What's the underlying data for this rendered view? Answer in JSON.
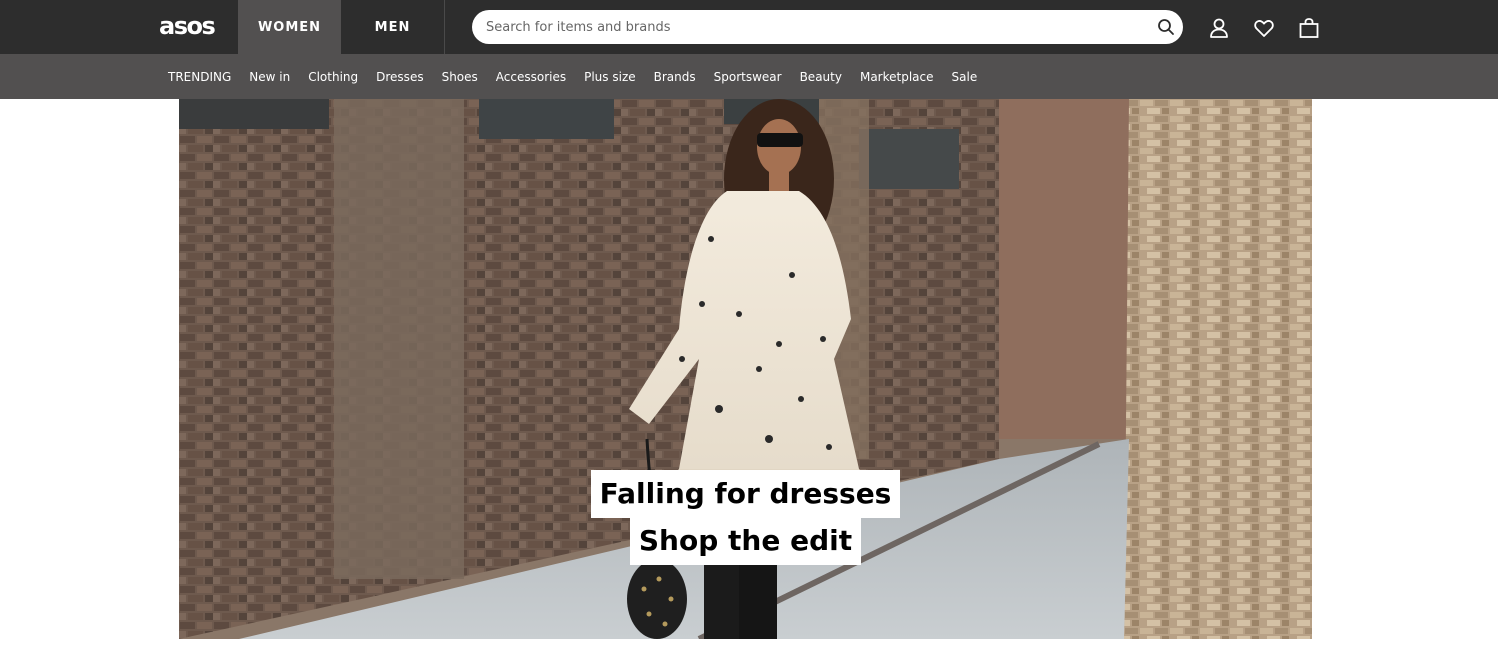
{
  "brand": {
    "logo_text": "asos"
  },
  "header": {
    "tabs": [
      {
        "label": "WOMEN",
        "active": true
      },
      {
        "label": "MEN",
        "active": false
      }
    ],
    "search": {
      "placeholder": "Search for items and brands",
      "value": ""
    },
    "icons": [
      "search-icon",
      "account-icon",
      "heart-icon",
      "bag-icon"
    ]
  },
  "nav": {
    "items": [
      {
        "label": "TRENDING"
      },
      {
        "label": "New in"
      },
      {
        "label": "Clothing"
      },
      {
        "label": "Dresses"
      },
      {
        "label": "Shoes"
      },
      {
        "label": "Accessories"
      },
      {
        "label": "Plus size"
      },
      {
        "label": "Brands"
      },
      {
        "label": "Sportswear"
      },
      {
        "label": "Beauty"
      },
      {
        "label": "Marketplace"
      },
      {
        "label": "Sale"
      }
    ]
  },
  "hero": {
    "line1": "Falling for dresses",
    "line2": "Shop the edit"
  },
  "colors": {
    "topbar": "#2d2d2d",
    "nav": "#525050",
    "active_tab": "#525050",
    "text_light": "#ffffff"
  }
}
